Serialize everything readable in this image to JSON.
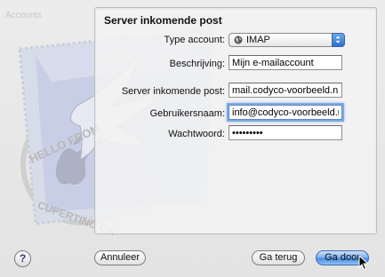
{
  "window": {
    "faded_title": "Accounts"
  },
  "stamp": {
    "text_top": "HELLO FROM",
    "text_bottom": "CUPERTINO CA"
  },
  "panel": {
    "heading": "Server inkomende post"
  },
  "form": {
    "account_type_label": "Type account:",
    "account_type_value": "IMAP",
    "description_label": "Beschrijving:",
    "description_value": "Mijn e-mailaccount",
    "incoming_server_label": "Server inkomende post:",
    "incoming_server_value": "mail.codyco-voorbeeld.nl",
    "username_label": "Gebruikersnaam:",
    "username_value": "info@codyco-voorbeeld.nl",
    "password_label": "Wachtwoord:",
    "password_value": "•••••••••"
  },
  "buttons": {
    "help": "?",
    "cancel": "Annuleer",
    "back": "Ga terug",
    "continue": "Ga door"
  },
  "colors": {
    "default_button": "#4a8ee3",
    "focus_ring": "#7ea9e2"
  }
}
